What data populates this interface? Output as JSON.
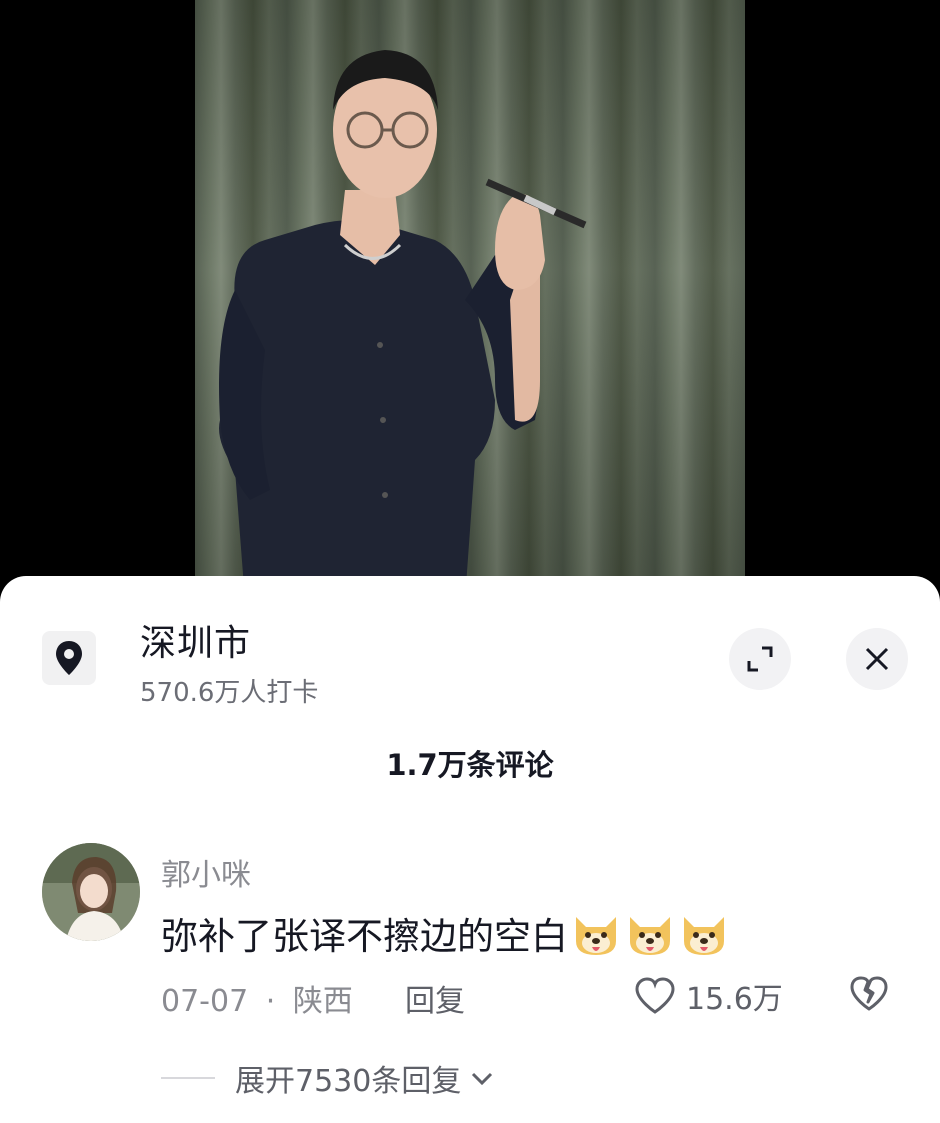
{
  "location": {
    "title": "深圳市",
    "checkins": "570.6万人打卡"
  },
  "comments_header": {
    "count_label": "1.7万条评论"
  },
  "comment": {
    "username": "郭小咪",
    "text": "弥补了张译不擦边的空白",
    "emoji_count": 3,
    "date": "07-07",
    "separator": "·",
    "region": "陕西",
    "reply_label": "回复",
    "like_count": "15.6万",
    "expand_replies_label": "展开7530条回复"
  },
  "icons": {
    "location": "location-pin-icon",
    "expand": "expand-icon",
    "close": "close-icon",
    "like": "heart-icon",
    "dislike": "broken-heart-icon",
    "chevron": "chevron-down-icon",
    "emoji": "doge-emoji-icon"
  }
}
